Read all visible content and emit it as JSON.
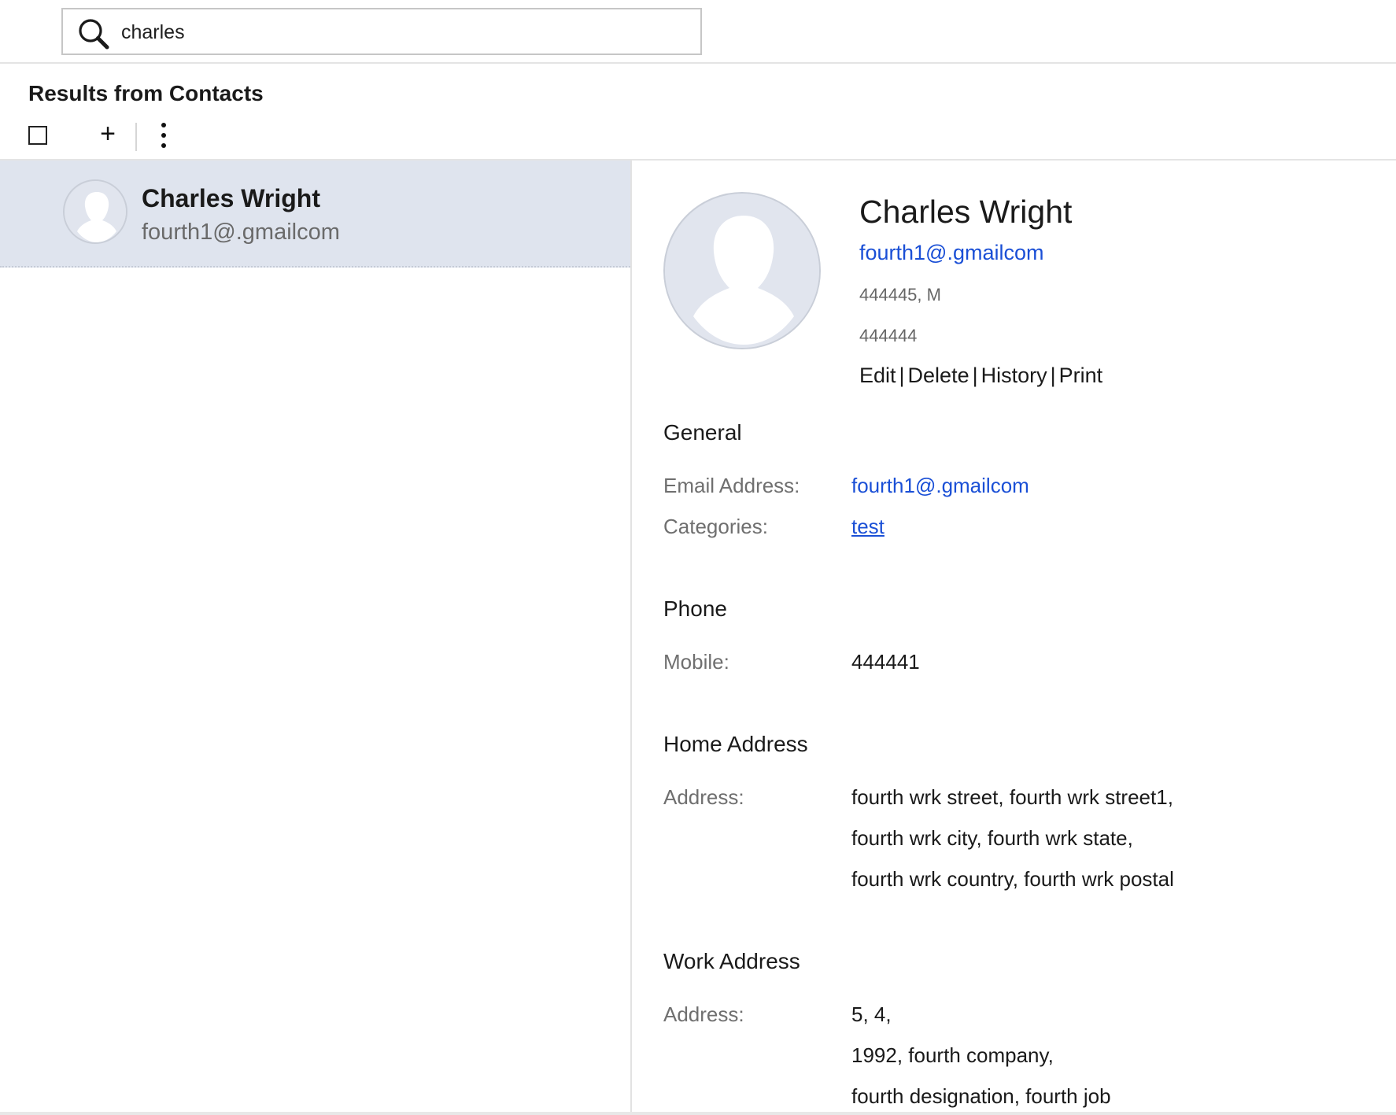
{
  "search": {
    "query": "charles"
  },
  "results": {
    "title": "Results from Contacts"
  },
  "toolbar": {
    "add_symbol": "+"
  },
  "list": {
    "items": [
      {
        "name": "Charles Wright",
        "email": "fourth1@.gmailcom"
      }
    ]
  },
  "detail": {
    "name": "Charles Wright",
    "email": "fourth1@.gmailcom",
    "line1": "444445, M",
    "line2": "444444",
    "actions": {
      "edit": "Edit",
      "delete": "Delete",
      "history": "History",
      "print": "Print",
      "separator": "|"
    },
    "general": {
      "title": "General",
      "email_label": "Email Address:",
      "email_value": "fourth1@.gmailcom",
      "categories_label": "Categories:",
      "categories_value": "test"
    },
    "phone": {
      "title": "Phone",
      "mobile_label": "Mobile:",
      "mobile_value": "444441"
    },
    "home_address": {
      "title": "Home Address",
      "label": "Address:",
      "lines": [
        "fourth wrk street, fourth wrk street1,",
        "fourth wrk city, fourth wrk state,",
        "fourth wrk country, fourth wrk postal"
      ]
    },
    "work_address": {
      "title": "Work Address",
      "label": "Address:",
      "lines": [
        "5, 4,",
        "1992, fourth company,",
        "fourth designation, fourth job"
      ]
    }
  },
  "colors": {
    "link": "#1a4fd6",
    "selected_row": "#dfe4ee",
    "muted_text": "#6f6f6f"
  },
  "icons": {
    "search": "search-icon",
    "more": "more-vertical-icon",
    "avatar": "avatar-placeholder-icon"
  }
}
